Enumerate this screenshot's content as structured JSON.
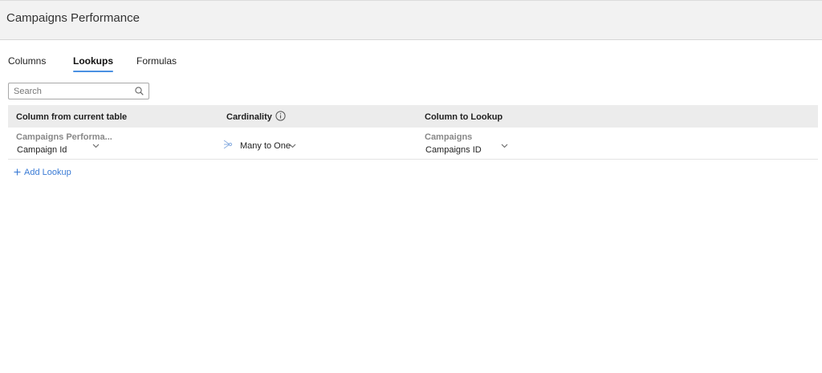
{
  "header": {
    "title": "Campaigns Performance"
  },
  "tabs": [
    {
      "label": "Columns",
      "active": false
    },
    {
      "label": "Lookups",
      "active": true
    },
    {
      "label": "Formulas",
      "active": false
    }
  ],
  "search": {
    "placeholder": "Search",
    "value": ""
  },
  "table": {
    "columns": [
      "Column from current table",
      "Cardinality",
      "Column to Lookup"
    ],
    "rows": [
      {
        "current_table": "Campaigns Performa...",
        "current_column": "Campaign Id",
        "cardinality": "Many to One",
        "lookup_table": "Campaigns",
        "lookup_column": "Campaigns ID"
      }
    ]
  },
  "add_lookup": {
    "label": "Add Lookup"
  },
  "colors": {
    "accent": "#4a90e2",
    "link": "#3a7bd5",
    "header_bg": "#f2f2f2",
    "table_head_bg": "#ececec"
  }
}
